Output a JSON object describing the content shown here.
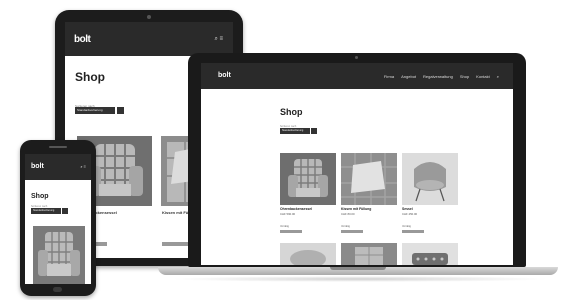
{
  "tablet": {
    "brand": "bolt",
    "header_icons": "⌕ ≡",
    "title": "Shop",
    "sort_label": "Sortieren nach",
    "sort_value": "Standardsortierung",
    "products": [
      {
        "name": "Ohrenbackensessel"
      },
      {
        "name": "Kissen mit Füllung"
      }
    ]
  },
  "laptop": {
    "brand": "bolt",
    "nav": [
      "Firma",
      "Angebot",
      "Regalverwaltung",
      "Shop",
      "Kontakt",
      "⌕"
    ],
    "title": "Shop",
    "sort_label": "Sortieren nach",
    "sort_value": "Standardsortierung",
    "products": [
      {
        "name": "Ohrenbackensessel",
        "price": "CHF 590.00",
        "stock": "Vorrätig"
      },
      {
        "name": "Kissen mit Füllung",
        "price": "CHF 80.00",
        "stock": "Vorrätig"
      },
      {
        "name": "Sessel",
        "price": "CHF 450.00",
        "stock": "Vorrätig"
      }
    ]
  },
  "phone": {
    "brand": "bolt",
    "header_icons": "⌕ ≡",
    "title": "Shop",
    "sort_label": "Sortieren nach",
    "sort_value": "Standardsortierung"
  },
  "colors": {
    "device_frame": "#1c1c1c",
    "site_header": "#2a2a2a",
    "background": "#ffffff"
  }
}
